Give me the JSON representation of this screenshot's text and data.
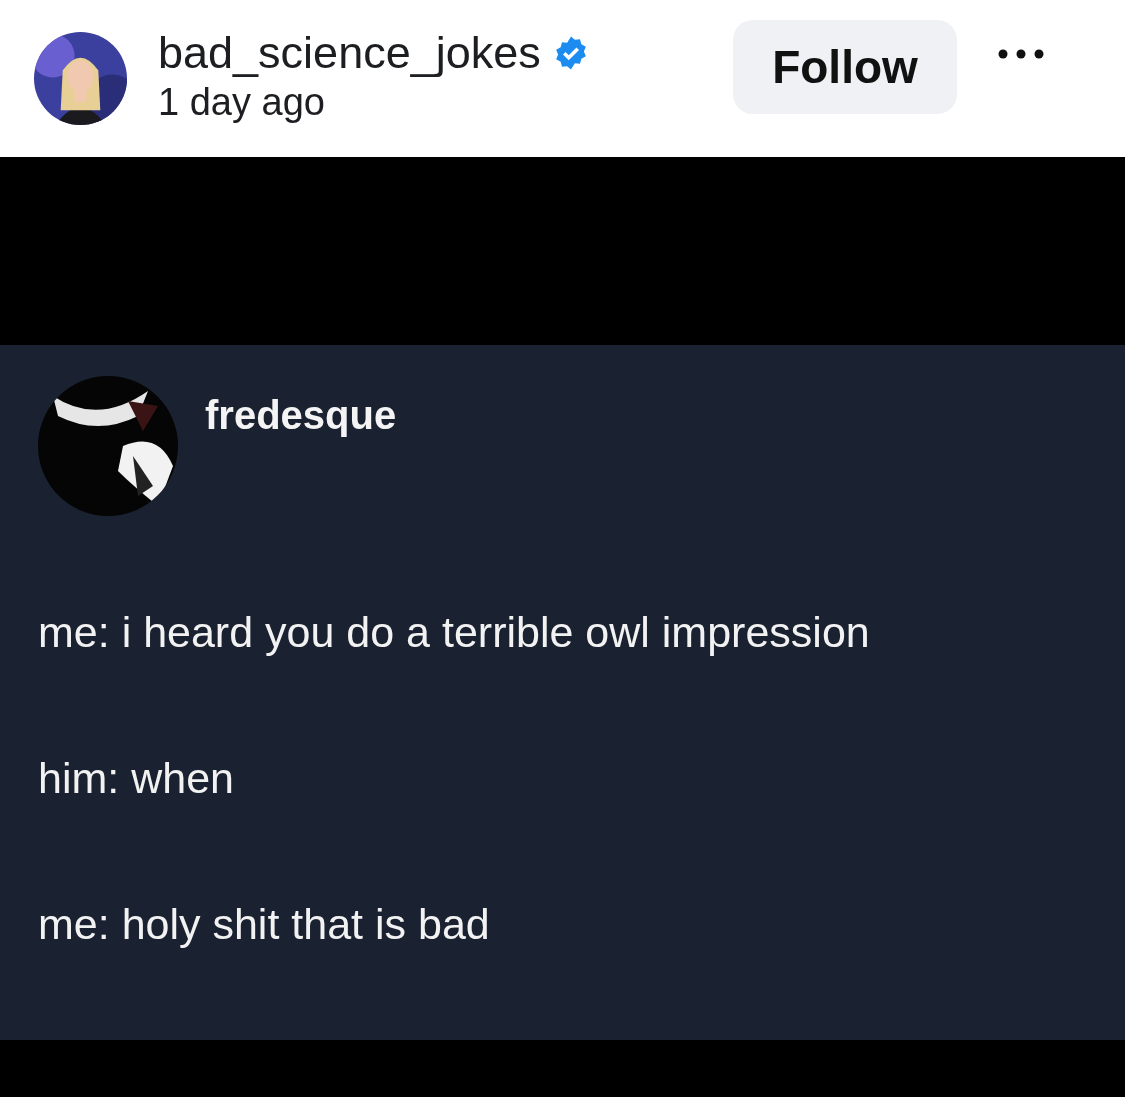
{
  "post_header": {
    "username": "bad_science_jokes",
    "verified": true,
    "time": "1 day ago",
    "follow_button": "Follow"
  },
  "post_image": {
    "author": "fredesque",
    "lines": [
      "me: i heard you do a terrible owl impression",
      "him: when",
      "me: holy shit that is bad"
    ]
  }
}
